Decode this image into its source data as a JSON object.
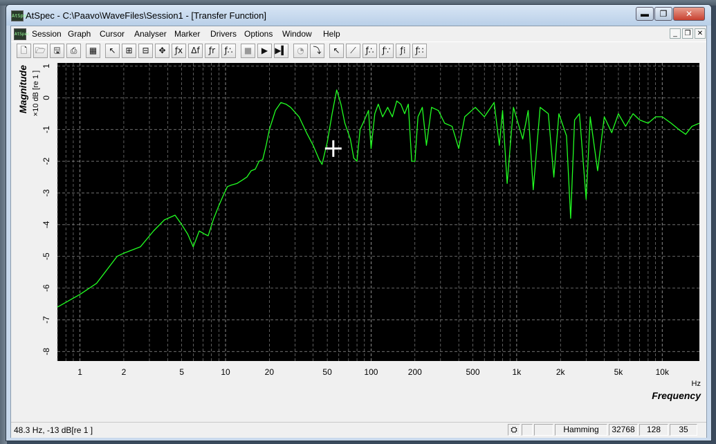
{
  "window": {
    "title": "AtSpec - C:\\Paavo\\WaveFiles\\Session1 - [Transfer Function]",
    "app_icon_text": "AtSpec",
    "min_glyph": "▬",
    "max_glyph": "❐",
    "close_glyph": "✕"
  },
  "menu": {
    "items": [
      "Session",
      "Graph",
      "Cursor",
      "Analyser",
      "Marker",
      "Drivers",
      "Options",
      "Window",
      "Help"
    ],
    "mdi_min": "_",
    "mdi_restore": "❐",
    "mdi_close": "✕"
  },
  "toolbar": {
    "buttons": [
      {
        "icon": "new-file-icon",
        "glyph": "🗋"
      },
      {
        "icon": "open-folder-icon",
        "glyph": "🗁"
      },
      {
        "icon": "save-icon",
        "glyph": "🖫"
      },
      {
        "icon": "print-icon",
        "glyph": "⎙"
      },
      {
        "icon": "export-graph-icon",
        "glyph": "▦"
      },
      {
        "icon": "pointer-icon",
        "glyph": "↖"
      },
      {
        "icon": "zoom-in-icon",
        "glyph": "⊞"
      },
      {
        "icon": "zoom-out-icon",
        "glyph": "⊟"
      },
      {
        "icon": "pan-icon",
        "glyph": "✥"
      },
      {
        "icon": "cursor-fx-icon",
        "glyph": "ƒx"
      },
      {
        "icon": "cursor-delta-f-icon",
        "glyph": "Δf"
      },
      {
        "icon": "cursor-fr-icon",
        "glyph": "ƒr"
      },
      {
        "icon": "cursor-multi-icon",
        "glyph": "ƒ∴"
      },
      {
        "icon": "stop-icon",
        "glyph": "■"
      },
      {
        "icon": "play-step-icon",
        "glyph": "▶"
      },
      {
        "icon": "run-icon",
        "glyph": "▶▍"
      },
      {
        "icon": "timer-icon",
        "glyph": "◔"
      },
      {
        "icon": "trigger-icon",
        "glyph": "⤵"
      },
      {
        "icon": "marker-pointer-icon",
        "glyph": "↖"
      },
      {
        "icon": "marker-tool-1-icon",
        "glyph": "⟋"
      },
      {
        "icon": "marker-tool-2-icon",
        "glyph": "ƒ∴"
      },
      {
        "icon": "marker-tool-3-icon",
        "glyph": "ƒ∵"
      },
      {
        "icon": "marker-tool-4-icon",
        "glyph": "ƒ⁞"
      },
      {
        "icon": "marker-tool-5-icon",
        "glyph": "ƒ∷"
      }
    ]
  },
  "colors": {
    "plot_background": "#000000",
    "trace": "#22ff22",
    "grid": "#9a9a9a",
    "axis_text": "#000000",
    "cursor": "#ffffff"
  },
  "chart_data": {
    "type": "line",
    "ylabel": "Magnitude",
    "yunit": "×10 dB [re 1 ]",
    "xlabel": "Frequency",
    "xunit": "Hz",
    "x_scale": "log",
    "xlim": [
      0.7,
      18000
    ],
    "ylim": [
      -8.3,
      1.1
    ],
    "grid": true,
    "x_ticks": [
      {
        "value": 1,
        "label": "1"
      },
      {
        "value": 2,
        "label": "2"
      },
      {
        "value": 5,
        "label": "5"
      },
      {
        "value": 10,
        "label": "10"
      },
      {
        "value": 20,
        "label": "20"
      },
      {
        "value": 50,
        "label": "50"
      },
      {
        "value": 100,
        "label": "100"
      },
      {
        "value": 200,
        "label": "200"
      },
      {
        "value": 500,
        "label": "500"
      },
      {
        "value": 1000,
        "label": "1k"
      },
      {
        "value": 2000,
        "label": "2k"
      },
      {
        "value": 5000,
        "label": "5k"
      },
      {
        "value": 10000,
        "label": "10k"
      }
    ],
    "y_ticks": [
      1,
      0,
      -1,
      -2,
      -3,
      -4,
      -5,
      -6,
      -7,
      -8
    ],
    "series": [
      {
        "points": [
          [
            0.7,
            -6.6
          ],
          [
            1.0,
            -6.2
          ],
          [
            1.3,
            -5.85
          ],
          [
            1.8,
            -5.0
          ],
          [
            2.0,
            -4.9
          ],
          [
            2.6,
            -4.7
          ],
          [
            3.2,
            -4.2
          ],
          [
            3.8,
            -3.85
          ],
          [
            4.5,
            -3.7
          ],
          [
            5.0,
            -4.0
          ],
          [
            5.5,
            -4.3
          ],
          [
            6.0,
            -4.7
          ],
          [
            6.6,
            -4.2
          ],
          [
            7.2,
            -4.3
          ],
          [
            7.6,
            -4.35
          ],
          [
            8.3,
            -3.8
          ],
          [
            9.0,
            -3.4
          ],
          [
            9.6,
            -3.1
          ],
          [
            10.3,
            -2.8
          ],
          [
            11.0,
            -2.75
          ],
          [
            12.0,
            -2.7
          ],
          [
            13.0,
            -2.6
          ],
          [
            14.0,
            -2.5
          ],
          [
            15.0,
            -2.3
          ],
          [
            16.0,
            -2.25
          ],
          [
            17.0,
            -2.0
          ],
          [
            18.0,
            -1.95
          ],
          [
            19.0,
            -1.5
          ],
          [
            20.0,
            -1.0
          ],
          [
            21.0,
            -0.7
          ],
          [
            22.0,
            -0.4
          ],
          [
            24.0,
            -0.15
          ],
          [
            26.0,
            -0.2
          ],
          [
            28.0,
            -0.3
          ],
          [
            32.0,
            -0.6
          ],
          [
            36.0,
            -1.1
          ],
          [
            40.0,
            -1.5
          ],
          [
            44.0,
            -1.95
          ],
          [
            46.0,
            -2.1
          ],
          [
            50.0,
            -1.4
          ],
          [
            54.0,
            -0.5
          ],
          [
            58.0,
            0.25
          ],
          [
            62.0,
            -0.2
          ],
          [
            66.0,
            -0.8
          ],
          [
            72.0,
            -1.3
          ],
          [
            76.0,
            -1.9
          ],
          [
            80.0,
            -2.0
          ],
          [
            84.0,
            -1.0
          ],
          [
            90.0,
            -0.7
          ],
          [
            96.0,
            -0.4
          ],
          [
            100.0,
            -1.6
          ],
          [
            106.0,
            -0.5
          ],
          [
            112.0,
            -0.2
          ],
          [
            120.0,
            -0.6
          ],
          [
            130.0,
            -0.3
          ],
          [
            140.0,
            -0.6
          ],
          [
            150.0,
            -0.1
          ],
          [
            160.0,
            -0.2
          ],
          [
            170.0,
            -0.5
          ],
          [
            180.0,
            -0.2
          ],
          [
            190.0,
            -2.0
          ],
          [
            200.0,
            -2.0
          ],
          [
            210.0,
            -0.6
          ],
          [
            225.0,
            -0.3
          ],
          [
            240.0,
            -1.5
          ],
          [
            260.0,
            -0.3
          ],
          [
            290.0,
            -0.4
          ],
          [
            320.0,
            -0.8
          ],
          [
            360.0,
            -0.9
          ],
          [
            400.0,
            -1.6
          ],
          [
            440.0,
            -0.6
          ],
          [
            520.0,
            -0.3
          ],
          [
            600.0,
            -0.6
          ],
          [
            700.0,
            -0.15
          ],
          [
            760.0,
            -1.5
          ],
          [
            800.0,
            -0.4
          ],
          [
            860.0,
            -2.7
          ],
          [
            950.0,
            -0.3
          ],
          [
            1100.0,
            -1.3
          ],
          [
            1200.0,
            -0.4
          ],
          [
            1300.0,
            -2.9
          ],
          [
            1450.0,
            -0.3
          ],
          [
            1650.0,
            -0.5
          ],
          [
            1800.0,
            -2.5
          ],
          [
            1950.0,
            -0.5
          ],
          [
            2200.0,
            -1.2
          ],
          [
            2350.0,
            -3.8
          ],
          [
            2500.0,
            -0.7
          ],
          [
            2700.0,
            -0.5
          ],
          [
            3000.0,
            -3.2
          ],
          [
            3200.0,
            -0.6
          ],
          [
            3600.0,
            -2.3
          ],
          [
            4000.0,
            -0.6
          ],
          [
            4500.0,
            -1.1
          ],
          [
            5000.0,
            -0.5
          ],
          [
            5600.0,
            -0.9
          ],
          [
            6300.0,
            -0.5
          ],
          [
            7000.0,
            -0.7
          ],
          [
            8000.0,
            -0.8
          ],
          [
            9000.0,
            -0.6
          ],
          [
            10000.0,
            -0.6
          ],
          [
            11500.0,
            -0.8
          ],
          [
            13000.0,
            -1.0
          ],
          [
            14500.0,
            -1.15
          ],
          [
            16000.0,
            -0.9
          ],
          [
            18000.0,
            -0.8
          ]
        ]
      }
    ]
  },
  "status": {
    "cursor_readout": "48.3 Hz, -13 dB[re 1 ]",
    "icon_glyph": "⛭",
    "window_fn": "Hamming",
    "fft_size": "32768",
    "averages": "128",
    "count": "35"
  }
}
